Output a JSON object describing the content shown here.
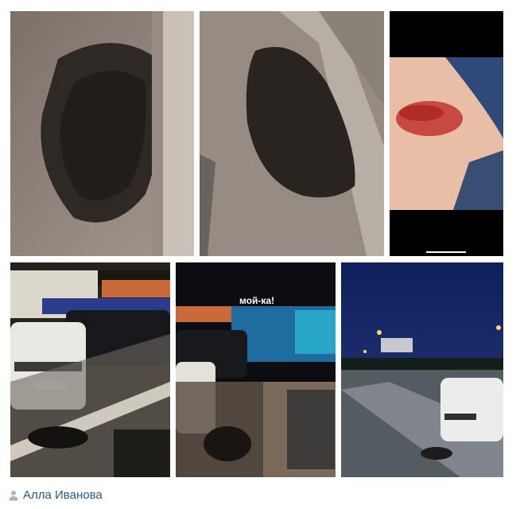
{
  "post": {
    "author": {
      "name": "Алла Иванова",
      "icon": "user-icon"
    },
    "photos": [
      {
        "name": "photo-pothole-closeup"
      },
      {
        "name": "photo-pothole-curb"
      },
      {
        "name": "photo-bruised-side"
      },
      {
        "name": "photo-parking-lot-cars"
      },
      {
        "name": "photo-carwash-pothole"
      },
      {
        "name": "photo-parking-lot-night"
      }
    ],
    "sign_text": "мой-ка!"
  },
  "colors": {
    "link": "#2a5885",
    "icon": "#aab4c1"
  }
}
